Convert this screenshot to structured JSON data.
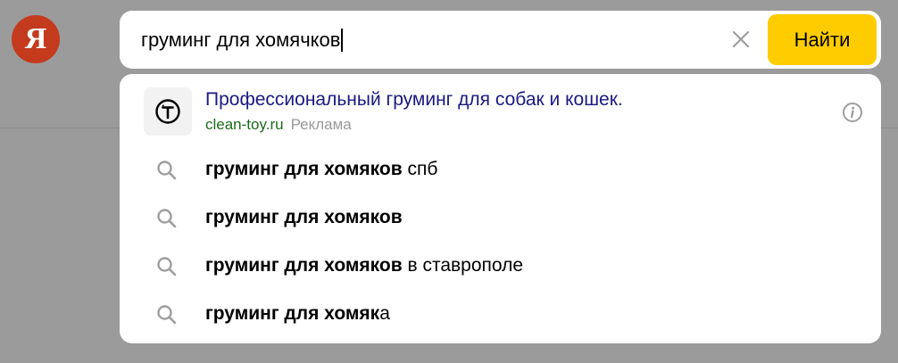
{
  "logo": {
    "letter": "Я"
  },
  "search": {
    "query": "груминг для хомячков",
    "button_label": "Найти",
    "clear_icon": "close-icon"
  },
  "dropdown": {
    "ad": {
      "title": "Профессиональный груминг для собак и кошек.",
      "domain": "clean-toy.ru",
      "label": "Реклама",
      "favicon": "tinkoff-t-logo",
      "info_icon": "info-icon"
    },
    "suggestions": [
      {
        "bold": "груминг для хомяков",
        "rest": " спб",
        "icon": "search-icon"
      },
      {
        "bold": "груминг для хомяков",
        "rest": "",
        "icon": "search-icon"
      },
      {
        "bold": "груминг для хомяков",
        "rest": " в ставрополе",
        "icon": "search-icon"
      },
      {
        "bold": "груминг для хомяк",
        "rest": "а",
        "icon": "search-icon"
      }
    ]
  },
  "colors": {
    "page_background": "#9b9b9b",
    "logo": "#c33a1d",
    "search_button": "#ffcc00",
    "ad_title": "#1a1a80",
    "ad_domain": "#1a6b1a",
    "ad_label": "#999999",
    "icon_gray": "#9e9e9e"
  }
}
